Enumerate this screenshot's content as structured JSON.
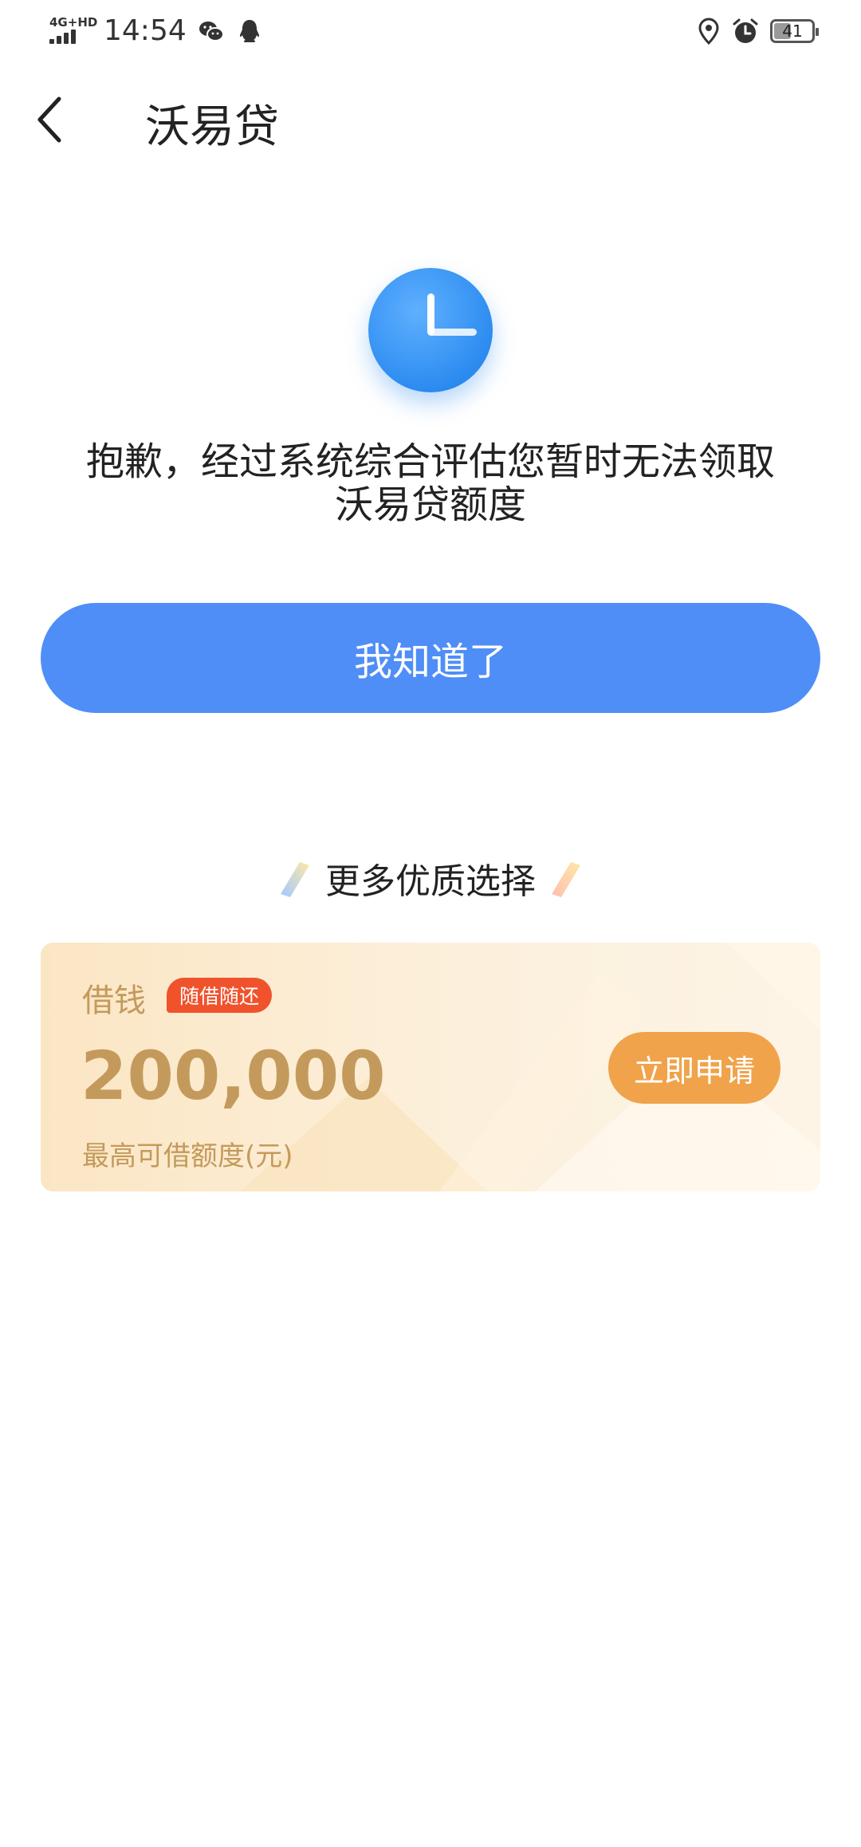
{
  "status_bar": {
    "network": "4G+HD",
    "time": "14:54",
    "battery": "41",
    "battery_level": 0.41
  },
  "header": {
    "title": "沃易贷"
  },
  "result": {
    "message": "抱歉，经过系统综合评估您暂时无法领取沃易贷额度",
    "confirm_label": "我知道了"
  },
  "more_section": {
    "title": "更多优质选择"
  },
  "loan_card": {
    "label": "借钱",
    "badge": "随借随还",
    "amount": "200,000",
    "amount_label": "最高可借额度(元)",
    "apply_label": "立即申请"
  },
  "colors": {
    "primary": "#4f8ef7",
    "card_text": "#c49a5c",
    "badge": "#f0522c",
    "apply": "#f0a34a"
  }
}
